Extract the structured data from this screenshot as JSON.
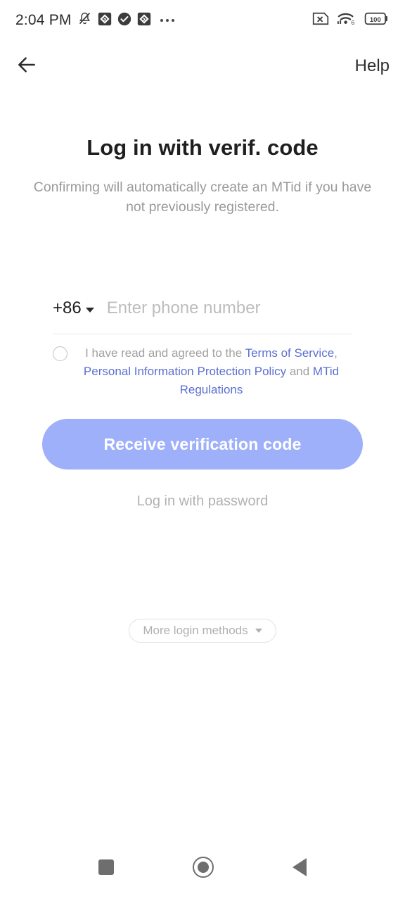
{
  "statusbar": {
    "time": "2:04 PM",
    "battery_level": "100",
    "wifi_standard": "6",
    "icons": [
      "bell-muted-icon",
      "app-badge-icon",
      "check-circle-icon",
      "app-badge-icon",
      "overflow-dots-icon",
      "sim-disabled-icon",
      "wifi-icon",
      "battery-icon"
    ]
  },
  "appbar": {
    "back_label": "back-arrow",
    "help_label": "Help"
  },
  "main": {
    "title": "Log in with verif. code",
    "subtitle": "Confirming will automatically create an MTid if you have not previously registered.",
    "phone": {
      "country_code": "+86",
      "value": "",
      "placeholder": "Enter phone number"
    },
    "agreement": {
      "checked": false,
      "prefix": "I have read and agreed to the ",
      "link1": "Terms of Service",
      "separator1": ", ",
      "link2": "Personal Information Protection Policy",
      "separator2": " and ",
      "link3": "MTid Regulations"
    },
    "primary_button": "Receive verification code",
    "password_link": "Log in with password",
    "more_methods": "More login methods"
  },
  "navbar": {
    "recents": "recents-square",
    "home": "home-circle",
    "back": "back-triangle"
  },
  "colors": {
    "primary_button_bg": "#9fb0fa",
    "link": "#5c6fd2",
    "muted_text": "#a0a0a0",
    "title_text": "#1f1f1f"
  }
}
